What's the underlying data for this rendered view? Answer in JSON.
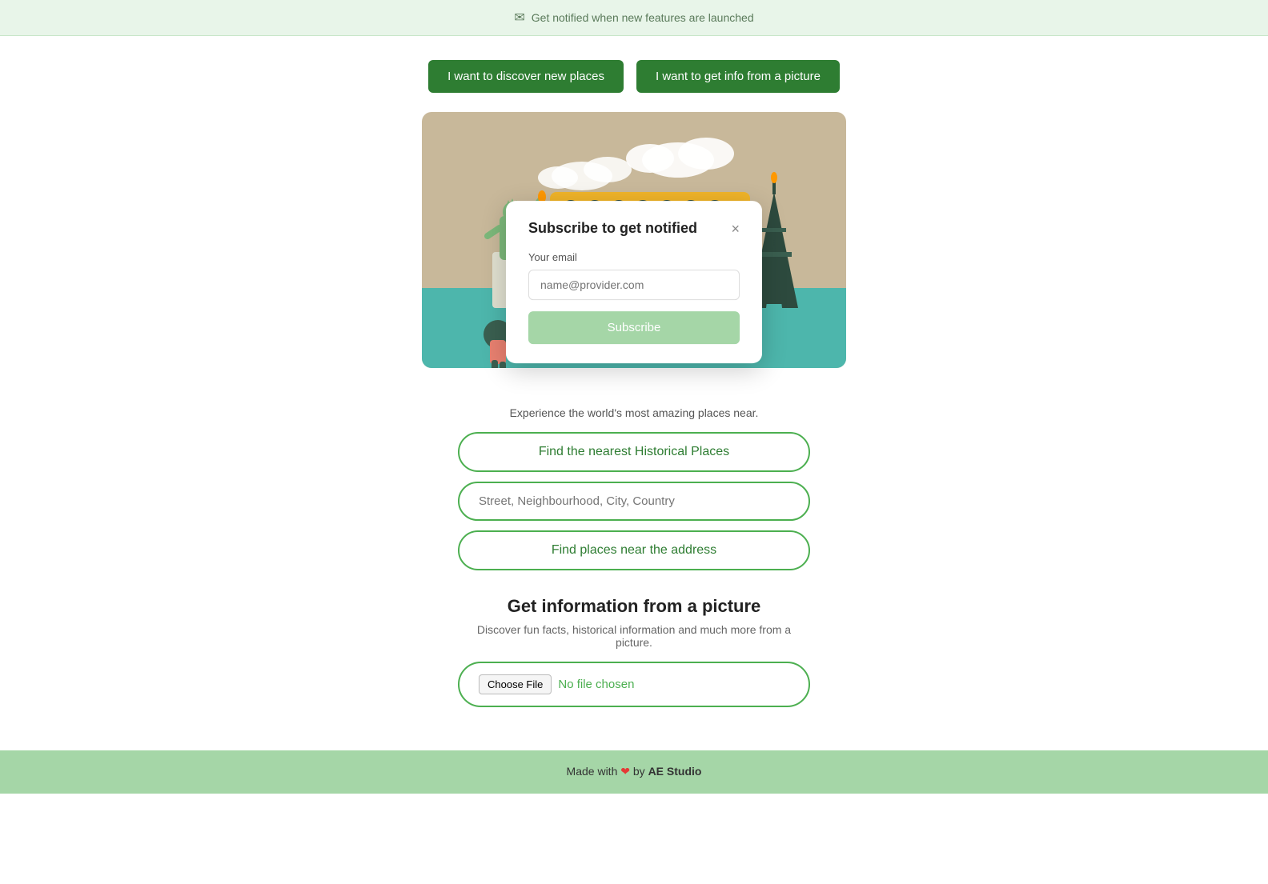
{
  "topBar": {
    "text": "Get notified when new features are launched",
    "icon": "✉"
  },
  "cta": {
    "button1": "I want to discover new places",
    "button2": "I want to get info from a picture"
  },
  "modal": {
    "title": "Subscribe to get notified",
    "emailLabel": "Your email",
    "emailPlaceholder": "name@provider.com",
    "subscribeBtn": "Subscribe",
    "closeIcon": "×"
  },
  "experienceText": "Experience the world's most amazing places near.",
  "actions": {
    "findHistorical": "Find the nearest Historical Places",
    "addressPlaceholder": "Street, Neighbourhood, City, Country",
    "findNearAddress": "Find places near the address"
  },
  "infoSection": {
    "title": "Get information from a picture",
    "subtitle": "Discover fun facts, historical information and much more from a picture.",
    "chooseFile": "Choose File",
    "noFile": "No file chosen"
  },
  "footer": {
    "text": "Made with",
    "heart": "❤",
    "by": "by",
    "brand": "AE Studio"
  }
}
